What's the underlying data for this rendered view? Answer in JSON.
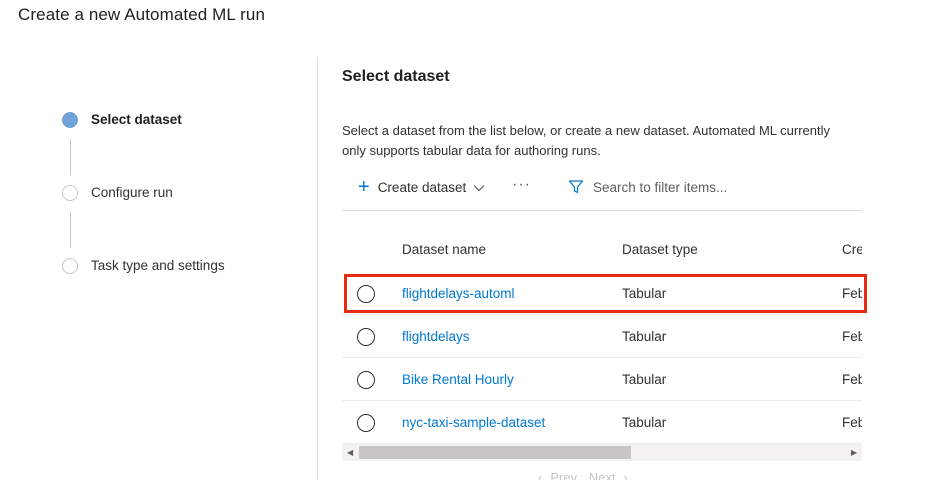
{
  "page": {
    "title": "Create a new Automated ML run"
  },
  "steps": [
    {
      "label": "Select dataset",
      "active": true
    },
    {
      "label": "Configure run",
      "active": false
    },
    {
      "label": "Task type and settings",
      "active": false
    }
  ],
  "main": {
    "section_title": "Select dataset",
    "description": "Select a dataset from the list below, or create a new dataset. Automated ML currently only supports tabular data for authoring runs."
  },
  "toolbar": {
    "create_label": "Create dataset",
    "more_label": "···",
    "filter_placeholder": "Search to filter items..."
  },
  "table": {
    "columns": [
      "Dataset name",
      "Dataset type",
      "Cre"
    ],
    "rows": [
      {
        "name": "flightdelays-automl",
        "type": "Tabular",
        "created": "Feb"
      },
      {
        "name": "flightdelays",
        "type": "Tabular",
        "created": "Feb"
      },
      {
        "name": "Bike Rental Hourly",
        "type": "Tabular",
        "created": "Feb"
      },
      {
        "name": "nyc-taxi-sample-dataset",
        "type": "Tabular",
        "created": "Feb"
      }
    ]
  },
  "pager": {
    "prev_label": "Prev",
    "next_label": "Next"
  },
  "colors": {
    "accent": "#0078d4",
    "highlight": "#e52c12",
    "step_active": "#71a3da"
  },
  "icons": {
    "create": "plus-icon",
    "dropdown": "chevron-down-icon",
    "filter": "filter-icon"
  }
}
